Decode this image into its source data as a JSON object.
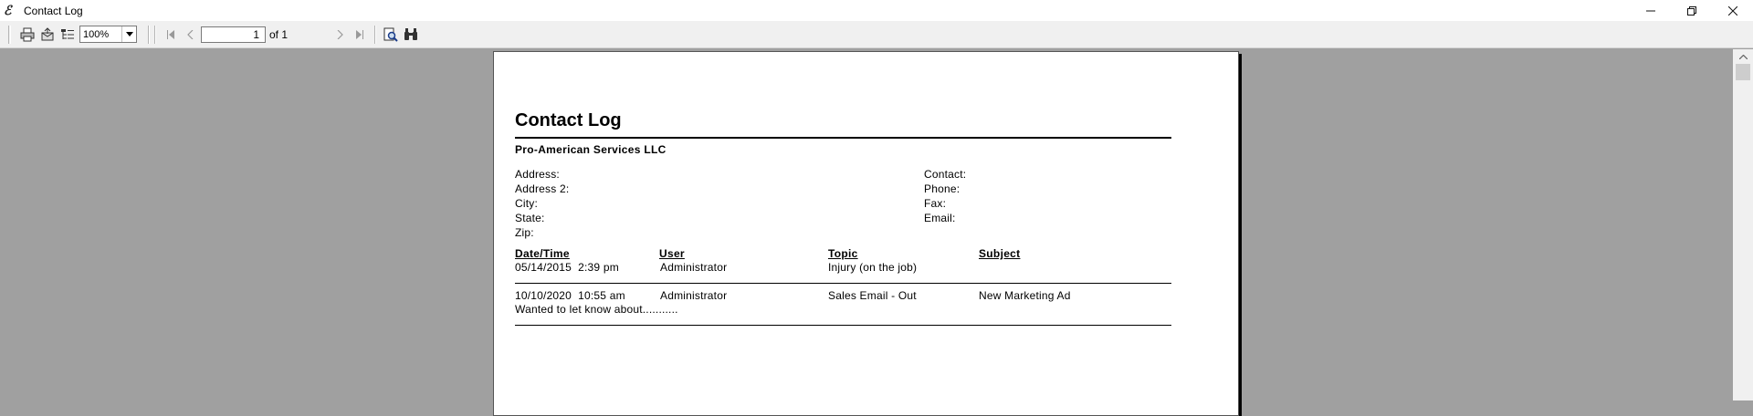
{
  "window": {
    "title": "Contact Log",
    "app_icon": "ℰ"
  },
  "toolbar": {
    "zoom_value": "100%",
    "page_number": "1",
    "page_of": "of 1"
  },
  "report": {
    "title": "Contact Log",
    "company": "Pro-American Services LLC",
    "left_fields": [
      "Address:",
      "Address 2:",
      "City:",
      "State:",
      "Zip:"
    ],
    "right_fields": [
      "Contact:",
      "Phone:",
      "Fax:",
      "Email:"
    ],
    "columns": [
      "Date/Time",
      "User",
      "Topic",
      "Subject"
    ],
    "rows": [
      {
        "datetime": "05/14/2015  2:39 pm",
        "user": "Administrator",
        "topic": "Injury (on the job)",
        "subject": "",
        "note": ""
      },
      {
        "datetime": "10/10/2020  10:55 am",
        "user": "Administrator",
        "topic": "Sales Email - Out",
        "subject": "New Marketing Ad",
        "note": "Wanted to let know about..........."
      }
    ]
  }
}
